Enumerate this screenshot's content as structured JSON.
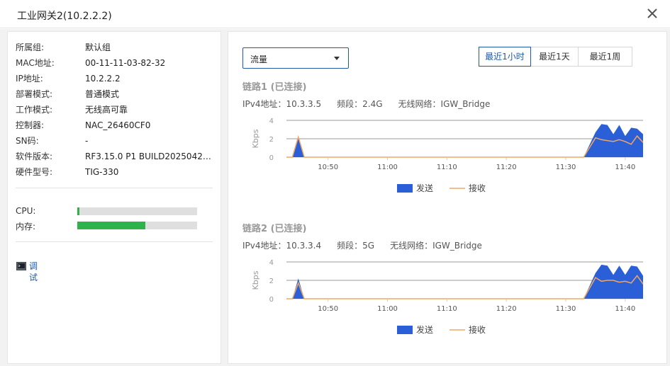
{
  "window": {
    "title": "工业网关2(10.2.2.2)"
  },
  "device_info": [
    {
      "label": "所属组:",
      "value": "默认组"
    },
    {
      "label": "MAC地址:",
      "value": "00-11-11-03-82-32"
    },
    {
      "label": "IP地址:",
      "value": "10.2.2.2"
    },
    {
      "label": "部署模式:",
      "value": "普通模式"
    },
    {
      "label": "工作模式:",
      "value": "无线高可靠"
    },
    {
      "label": "控制器:",
      "value": "NAC_26460CF0"
    },
    {
      "label": "SN码:",
      "value": "-"
    },
    {
      "label": "软件版本:",
      "value": "RF3.15.0 P1 BUILD20250420..."
    },
    {
      "label": "硬件型号:",
      "value": "TIG-330"
    }
  ],
  "resources": [
    {
      "label": "CPU:",
      "value": 0.02
    },
    {
      "label": "内存:",
      "value": 0.57
    }
  ],
  "debug": {
    "label": "调试",
    "icon": "terminal-icon"
  },
  "metric_select": {
    "value": "流量"
  },
  "range_tabs": [
    {
      "label": "最近1小时",
      "active": true
    },
    {
      "label": "最近1天",
      "active": false
    },
    {
      "label": "最近1周",
      "active": false
    }
  ],
  "links": [
    {
      "title": "链路1 (已连接)",
      "ipv4": "IPv4地址：10.3.3.5",
      "band": "频段：2.4G",
      "ssid": "无线网络：IGW_Bridge"
    },
    {
      "title": "链路2 (已连接)",
      "ipv4": "IPv4地址：10.3.3.4",
      "band": "频段：5G",
      "ssid": "无线网络：IGW_Bridge"
    }
  ],
  "colors": {
    "accent": "#1e5aa8",
    "send": "#2a5fd8",
    "recv": "#f0a860",
    "cpu": "#2db34a"
  },
  "chart_data": [
    {
      "type": "area",
      "ylabel": "Kbps",
      "x_ticks": [
        "10:50",
        "11:00",
        "11:10",
        "11:20",
        "11:30",
        "11:40"
      ],
      "x_range": [
        "10:43",
        "11:43"
      ],
      "ylim": [
        0,
        4
      ],
      "y_ticks": [
        0,
        2,
        4
      ],
      "legend_position": "bottom",
      "series": [
        {
          "name": "发送",
          "style": "area",
          "points": [
            [
              "10:43",
              0
            ],
            [
              "10:44",
              0
            ],
            [
              "10:45",
              2.3
            ],
            [
              "10:46",
              0
            ],
            [
              "11:33",
              0
            ],
            [
              "11:35",
              2.7
            ],
            [
              "11:36",
              3.6
            ],
            [
              "11:37",
              3.5
            ],
            [
              "11:38",
              2.5
            ],
            [
              "11:39",
              3.5
            ],
            [
              "11:40",
              2.3
            ],
            [
              "11:41",
              3.2
            ],
            [
              "11:42",
              3.1
            ],
            [
              "11:43",
              2.5
            ]
          ]
        },
        {
          "name": "接收",
          "style": "line",
          "points": [
            [
              "10:43",
              0
            ],
            [
              "10:44",
              0
            ],
            [
              "10:45",
              2.2
            ],
            [
              "10:46",
              0
            ],
            [
              "11:33",
              0
            ],
            [
              "11:35",
              2.1
            ],
            [
              "11:36",
              1.9
            ],
            [
              "11:37",
              1.8
            ],
            [
              "11:38",
              1.7
            ],
            [
              "11:39",
              1.9
            ],
            [
              "11:40",
              1.7
            ],
            [
              "11:41",
              1.4
            ],
            [
              "11:42",
              2.3
            ],
            [
              "11:43",
              1.6
            ]
          ]
        }
      ]
    },
    {
      "type": "area",
      "ylabel": "Kbps",
      "x_ticks": [
        "10:50",
        "11:00",
        "11:10",
        "11:20",
        "11:30",
        "11:40"
      ],
      "x_range": [
        "10:43",
        "11:43"
      ],
      "ylim": [
        0,
        4
      ],
      "y_ticks": [
        0,
        2,
        4
      ],
      "legend_position": "bottom",
      "series": [
        {
          "name": "发送",
          "style": "area",
          "points": [
            [
              "10:43",
              0
            ],
            [
              "10:44",
              0
            ],
            [
              "10:45",
              2.2
            ],
            [
              "10:46",
              0
            ],
            [
              "11:33",
              0
            ],
            [
              "11:35",
              2.8
            ],
            [
              "11:36",
              3.7
            ],
            [
              "11:37",
              3.6
            ],
            [
              "11:38",
              2.6
            ],
            [
              "11:39",
              3.6
            ],
            [
              "11:40",
              2.6
            ],
            [
              "11:41",
              3.6
            ],
            [
              "11:42",
              3.5
            ],
            [
              "11:43",
              2.5
            ]
          ]
        },
        {
          "name": "接收",
          "style": "line",
          "points": [
            [
              "10:43",
              0
            ],
            [
              "10:44",
              0
            ],
            [
              "10:45",
              1.7
            ],
            [
              "10:46",
              0
            ],
            [
              "11:33",
              0
            ],
            [
              "11:35",
              2.3
            ],
            [
              "11:36",
              1.9
            ],
            [
              "11:37",
              2.0
            ],
            [
              "11:38",
              2.0
            ],
            [
              "11:39",
              1.8
            ],
            [
              "11:40",
              1.9
            ],
            [
              "11:41",
              1.7
            ],
            [
              "11:42",
              2.5
            ],
            [
              "11:43",
              1.6
            ]
          ]
        }
      ]
    }
  ]
}
